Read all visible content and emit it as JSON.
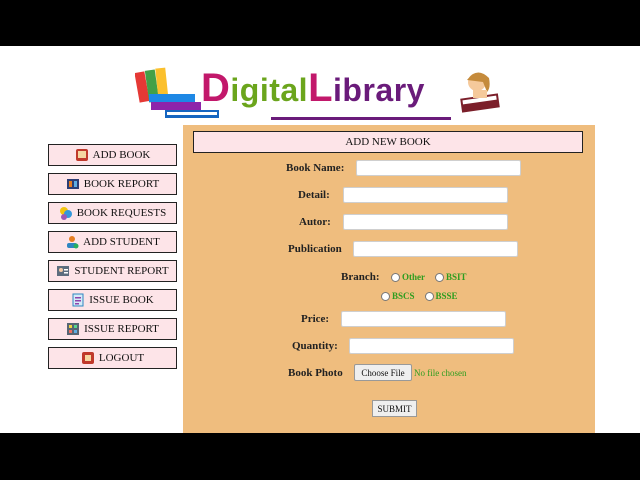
{
  "header": {
    "logo_part1": "D",
    "logo_part2": "igital",
    "logo_part3": "L",
    "logo_part4": "ibrary"
  },
  "sidebar": {
    "items": [
      {
        "label": "ADD BOOK",
        "icon": "book-icon"
      },
      {
        "label": "BOOK REPORT",
        "icon": "report-icon"
      },
      {
        "label": "BOOK REQUESTS",
        "icon": "requests-icon"
      },
      {
        "label": "ADD STUDENT",
        "icon": "add-student-icon"
      },
      {
        "label": "STUDENT REPORT",
        "icon": "student-report-icon"
      },
      {
        "label": "ISSUE BOOK",
        "icon": "issue-book-icon"
      },
      {
        "label": "ISSUE REPORT",
        "icon": "issue-report-icon"
      },
      {
        "label": "LOGOUT",
        "icon": "logout-icon"
      }
    ]
  },
  "form": {
    "title": "ADD NEW BOOK",
    "book_name_label": "Book Name:",
    "detail_label": "Detail:",
    "autor_label": "Autor:",
    "publication_label": "Publication",
    "branch_label": "Branch:",
    "branch_options": [
      "Other",
      "BSIT",
      "BSCS",
      "BSSE"
    ],
    "price_label": "Price:",
    "quantity_label": "Quantity:",
    "photo_label": "Book Photo",
    "choose_file": "Choose File",
    "file_status": "No file chosen",
    "submit": "SUBMIT"
  },
  "colors": {
    "panel": "#efbd7e",
    "button_bg": "#fde4e8",
    "radio_text": "#2e9d1f",
    "logo_pink": "#c2186b",
    "logo_green": "#6ba51c"
  }
}
